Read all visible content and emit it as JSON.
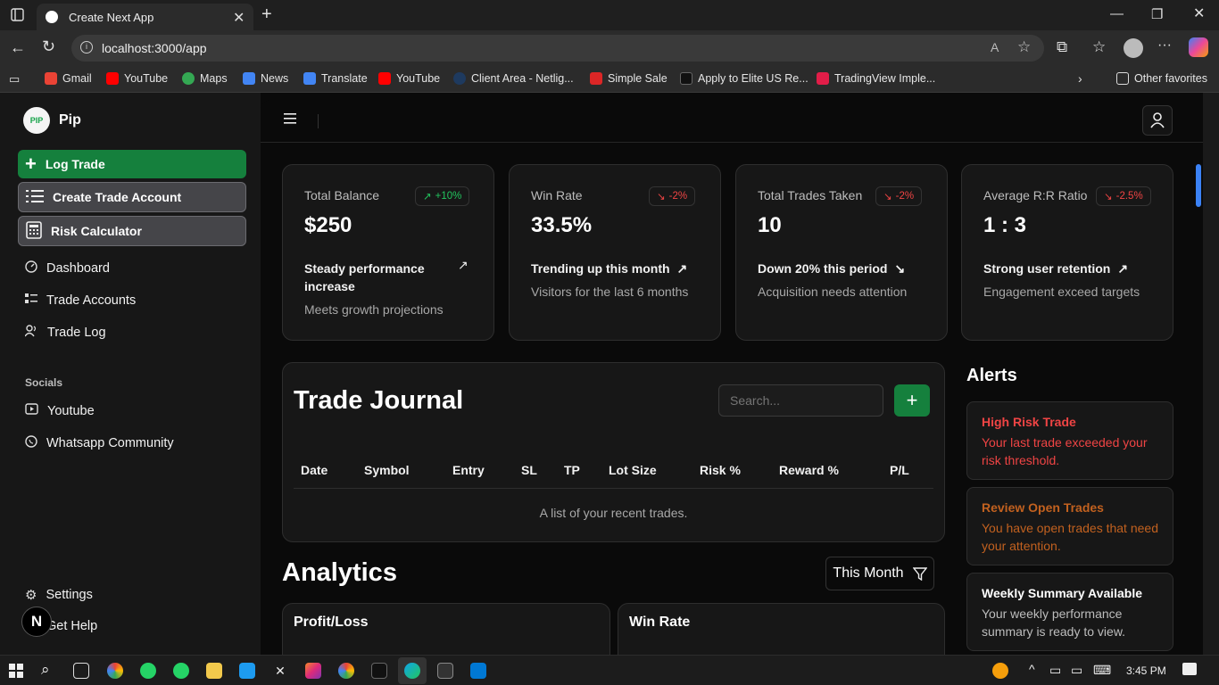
{
  "browser": {
    "tab_title": "Create Next App",
    "url": "localhost:3000/app",
    "favorites": [
      "Gmail",
      "YouTube",
      "Maps",
      "News",
      "Translate",
      "YouTube",
      "Client Area - Netlig...",
      "Simple Sale",
      "Apply to Elite US Re...",
      "TradingView Imple..."
    ],
    "other_favorites": "Other favorites"
  },
  "sidebar": {
    "brand": "Pip",
    "logo_text": "PIP",
    "log_trade": "Log Trade",
    "create_account": "Create Trade Account",
    "risk_calc": "Risk Calculator",
    "nav": [
      "Dashboard",
      "Trade Accounts",
      "Trade Log"
    ],
    "socials_heading": "Socials",
    "socials": [
      "Youtube",
      "Whatsapp Community"
    ],
    "settings": "Settings",
    "help": "Get Help",
    "next_badge": "N"
  },
  "stats": [
    {
      "label": "Total Balance",
      "value": "$250",
      "badge": "+10%",
      "trend": "up",
      "headline": "Steady performance increase",
      "sub": "Meets growth projections"
    },
    {
      "label": "Win Rate",
      "value": "33.5%",
      "badge": "-2%",
      "trend": "down",
      "headline": "Trending up this month",
      "sub": "Visitors for the last 6 months"
    },
    {
      "label": "Total Trades Taken",
      "value": "10",
      "badge": "-2%",
      "trend": "down",
      "headline": "Down 20% this period",
      "sub": "Acquisition needs attention"
    },
    {
      "label": "Average R:R Ratio",
      "value": "1 : 3",
      "badge": "-2.5%",
      "trend": "down",
      "headline": "Strong user retention",
      "sub": "Engagement exceed targets"
    }
  ],
  "journal": {
    "title": "Trade Journal",
    "search_placeholder": "Search...",
    "add_label": "+",
    "columns": [
      "Date",
      "Symbol",
      "Entry",
      "SL",
      "TP",
      "Lot Size",
      "Risk %",
      "Reward %",
      "P/L"
    ],
    "caption": "A list of your recent trades."
  },
  "analytics": {
    "title": "Analytics",
    "filter": "This Month",
    "panels": [
      "Profit/Loss",
      "Win Rate"
    ]
  },
  "alerts": {
    "title": "Alerts",
    "items": [
      {
        "title": "High Risk Trade",
        "body": "Your last trade exceeded your risk threshold.",
        "color": "#ef4444"
      },
      {
        "title": "Review Open Trades",
        "body": "You have open trades that need your attention.",
        "color": "#c2611f"
      },
      {
        "title": "Weekly Summary Available",
        "body": "Your weekly performance summary is ready to view.",
        "color": "#ffffff"
      }
    ]
  },
  "taskbar": {
    "time": "3:45 PM"
  },
  "colors": {
    "accent_green": "#15803d",
    "up": "#22c55e",
    "down": "#ef4444"
  }
}
